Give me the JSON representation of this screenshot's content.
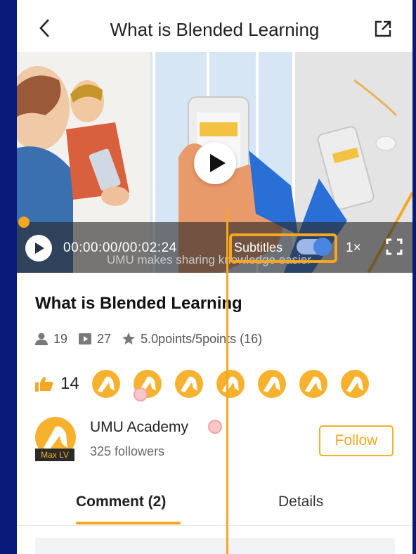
{
  "header": {
    "title": "What is Blended Learning"
  },
  "video": {
    "time": "00:00:00/00:02:24",
    "subtitle_caption": "UMU makes sharing knowledge easier",
    "subtitles_label": "Subtitles",
    "subtitles_on": true,
    "speed": "1×"
  },
  "course": {
    "title": "What is Blended Learning",
    "learners": "19",
    "videos": "27",
    "rating": "5.0points/5points (16)",
    "likes": "14"
  },
  "author": {
    "name": "UMU Academy",
    "followers": "325 followers",
    "level": "Max LV",
    "follow_label": "Follow"
  },
  "tabs": {
    "comment": "Comment (2)",
    "details": "Details"
  },
  "colors": {
    "accent": "#f5a623",
    "page_bg": "#0a1a7a",
    "toggle": "#4a86e0"
  }
}
